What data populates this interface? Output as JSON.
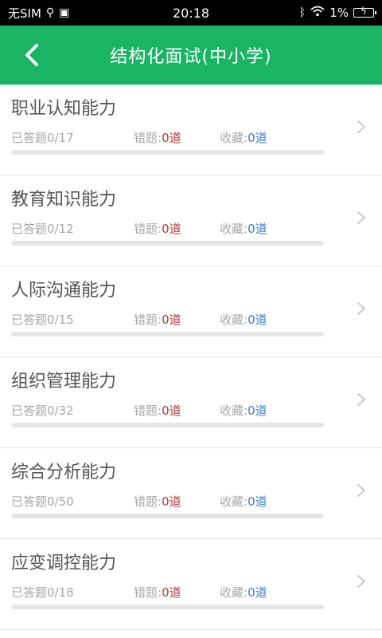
{
  "statusbar": {
    "carrier": "无SIM",
    "time": "20:18",
    "battery": "1%"
  },
  "header": {
    "title": "结构化面试(中小学)"
  },
  "stats_labels": {
    "answered": "已答题",
    "wrong": "错题:",
    "favorite": "收藏:"
  },
  "items": [
    {
      "title": "职业认知能力",
      "answered": "0/17",
      "wrong": "0道",
      "favorite": "0道",
      "progress": 0
    },
    {
      "title": "教育知识能力",
      "answered": "0/12",
      "wrong": "0道",
      "favorite": "0道",
      "progress": 0
    },
    {
      "title": "人际沟通能力",
      "answered": "0/15",
      "wrong": "0道",
      "favorite": "0道",
      "progress": 0
    },
    {
      "title": "组织管理能力",
      "answered": "0/32",
      "wrong": "0道",
      "favorite": "0道",
      "progress": 0
    },
    {
      "title": "综合分析能力",
      "answered": "0/50",
      "wrong": "0道",
      "favorite": "0道",
      "progress": 0
    },
    {
      "title": "应变调控能力",
      "answered": "0/18",
      "wrong": "0道",
      "favorite": "0道",
      "progress": 0
    }
  ]
}
